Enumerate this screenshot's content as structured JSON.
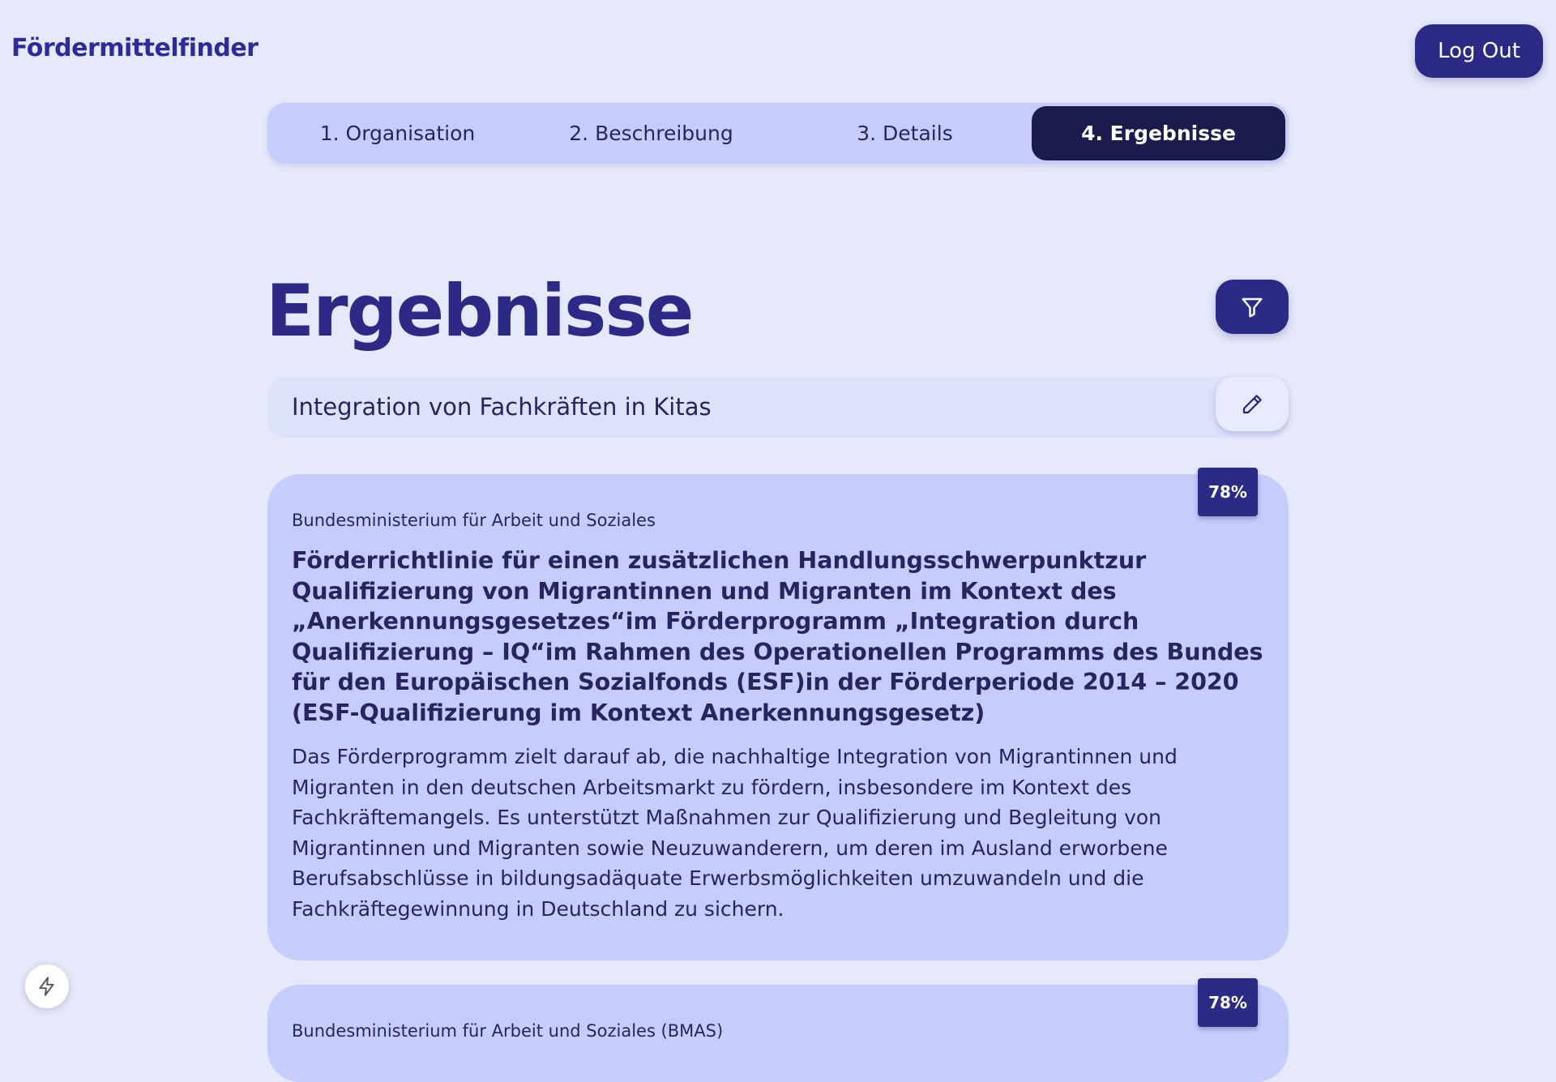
{
  "header": {
    "logo": "Fördermittelfinder",
    "logout_label": "Log Out"
  },
  "stepper": {
    "steps": [
      {
        "label": "1. Organisation"
      },
      {
        "label": "2. Beschreibung"
      },
      {
        "label": "3. Details"
      },
      {
        "label": "4. Ergebnisse"
      }
    ],
    "active_step": 4
  },
  "main": {
    "title": "Ergebnisse",
    "query": "Integration von Fachkräften in Kitas",
    "filter_icon": "filter-icon",
    "edit_icon": "pencil-icon"
  },
  "results": [
    {
      "match": "78%",
      "ministry": "Bundesministerium für Arbeit und Soziales",
      "title": "Förderrichtlinie für einen zusätzlichen Handlungsschwerpunktzur Qualifizierung von Migrantinnen und Migranten im Kontext des „Anerkennungsgesetzes“im Förderprogramm „Integration durch Qualifizierung – IQ“im Rahmen des Operationellen Programms des Bundes für den Europäischen Sozialfonds (ESF)in der Förderperiode 2014 – 2020 (ESF-Qualifizierung im Kontext Anerkennungsgesetz)",
      "description": "Das Förderprogramm zielt darauf ab, die nachhaltige Integration von Migrantinnen und Migranten in den deutschen Arbeitsmarkt zu fördern, insbesondere im Kontext des Fachkräftemangels. Es unterstützt Maßnahmen zur Qualifizierung und Begleitung von Migrantinnen und Migranten sowie Neuzuwanderern, um deren im Ausland erworbene Berufsabschlüsse in bildungsadäquate Erwerbsmöglichkeiten umzuwandeln und die Fachkräftegewinnung in Deutschland zu sichern."
    },
    {
      "match": "78%",
      "ministry": "Bundesministerium für Arbeit und Soziales (BMAS)"
    }
  ],
  "colors": {
    "background": "#e6e9fb",
    "card": "#c6cdfc",
    "primary": "#2b2a86",
    "active_step": "#1c1b4d",
    "text": "#27245f"
  },
  "floating": {
    "icon": "lightning-icon"
  }
}
